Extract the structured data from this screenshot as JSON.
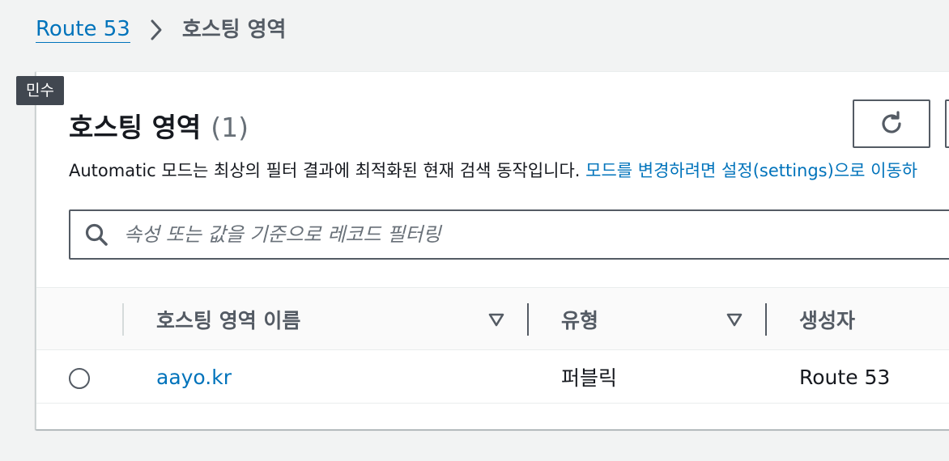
{
  "breadcrumb": {
    "root_label": "Route 53",
    "current_label": "호스팅 영역"
  },
  "tooltip": {
    "label": "민수"
  },
  "panel": {
    "title": "호스팅 영역",
    "count": "(1)",
    "info_text": "Automatic 모드는 최상의 필터 결과에 최적화된 현재 검색 동작입니다. ",
    "info_link": "모드를 변경하려면 설정(settings)으로 이동하"
  },
  "search": {
    "placeholder": "속성 또는 값을 기준으로 레코드 필터링",
    "value": ""
  },
  "table": {
    "columns": [
      {
        "label": "호스팅 영역 이름",
        "sortable": true
      },
      {
        "label": "유형",
        "sortable": true
      },
      {
        "label": "생성자",
        "sortable": false
      }
    ],
    "rows": [
      {
        "name": "aayo.kr",
        "type": "퍼블릭",
        "created_by": "Route 53",
        "selected": false
      }
    ]
  },
  "colors": {
    "link": "#0073bb",
    "border": "#545b64",
    "background": "#f2f3f3"
  },
  "icons": {
    "breadcrumb_separator": "chevron-right-icon",
    "refresh": "refresh-icon",
    "search": "search-icon",
    "sort": "sort-caret-down-icon"
  }
}
